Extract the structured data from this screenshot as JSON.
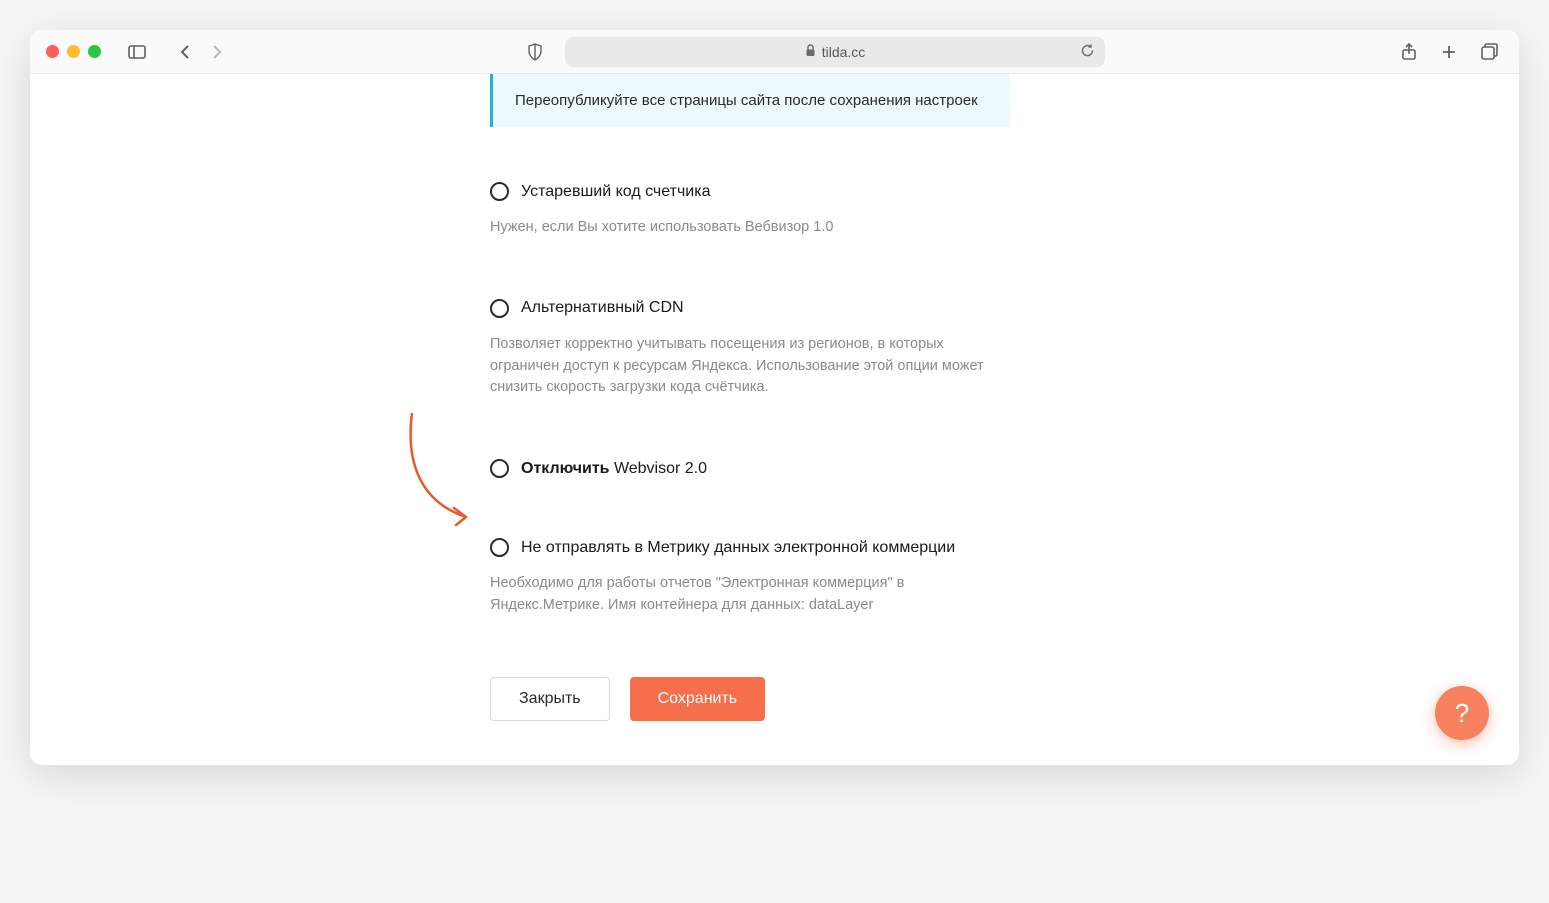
{
  "browser": {
    "domain": "tilda.cc"
  },
  "banner": {
    "text": "Переопубликуйте все страницы сайта после сохранения настроек"
  },
  "options": {
    "opt1": {
      "label": "Устаревший код счетчика",
      "desc": "Нужен, если Вы хотите использовать Вебвизор 1.0"
    },
    "opt2": {
      "label": "Альтернативный CDN",
      "desc": "Позволяет корректно учитывать посещения из регионов, в которых ограничен доступ к ресурсам Яндекса. Использование этой опции может снизить скорость загрузки кода счётчика."
    },
    "opt3": {
      "label_bold": "Отключить",
      "label_rest": " Webvisor 2.0"
    },
    "opt4": {
      "label": "Не отправлять в Метрику данных электронной коммерции",
      "desc": "Необходимо для работы отчетов \"Электронная коммерция\" в Яндекс.Метрике. Имя контейнера для данных: dataLayer"
    }
  },
  "buttons": {
    "close": "Закрыть",
    "save": "Сохранить"
  },
  "help": {
    "label": "?"
  }
}
